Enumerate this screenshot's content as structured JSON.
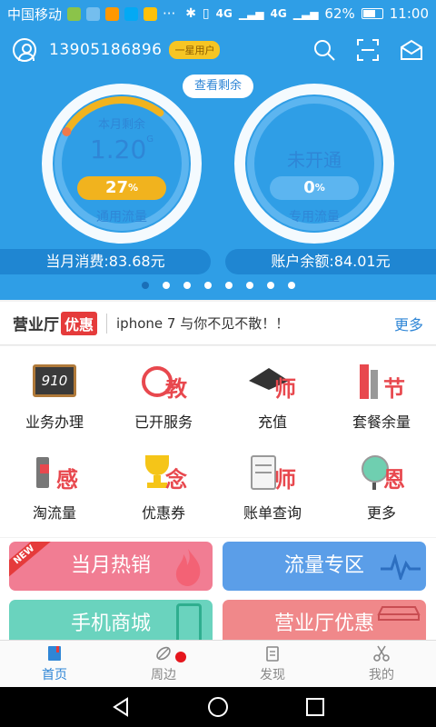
{
  "status_bar": {
    "carrier": "中国移动",
    "network": "4G",
    "network2": "4G",
    "battery": "62%",
    "time": "11:00",
    "more": "···"
  },
  "header": {
    "phone": "13905186896",
    "vip_badge": "一星用户",
    "query_button": "查看剩余",
    "gauge_general": {
      "caption": "本月剩余",
      "value": "1.20",
      "unit": "G",
      "percent": "27",
      "percent_sign": "%",
      "label": "通用流量",
      "fill_fraction": 0.27
    },
    "gauge_special": {
      "status": "未开通",
      "percent": "0",
      "percent_sign": "%",
      "label": "专用流量",
      "fill_fraction": 0
    },
    "spend": "当月消费:83.68元",
    "balance": "账户余额:84.01元",
    "dots_count": 8,
    "dots_active": 0
  },
  "news": {
    "brand": "营业厅",
    "brand_tag": "优惠",
    "headline": "iphone 7 与你不见不散！！",
    "more": "更多"
  },
  "grid": [
    {
      "label": "业务办理",
      "icon": "chalkboard-910-icon",
      "icon_text": "910"
    },
    {
      "label": "已开服务",
      "icon": "alarm-clock-icon",
      "icon_text": "教"
    },
    {
      "label": "充值",
      "icon": "graduation-cap-icon",
      "icon_text": "师"
    },
    {
      "label": "套餐余量",
      "icon": "books-icon",
      "icon_text": "节"
    },
    {
      "label": "淘流量",
      "icon": "bookmark-stand-icon",
      "icon_text": "感"
    },
    {
      "label": "优惠券",
      "icon": "trophy-icon",
      "icon_text": "念"
    },
    {
      "label": "账单查询",
      "icon": "scroll-icon",
      "icon_text": "师"
    },
    {
      "label": "更多",
      "icon": "globe-icon",
      "icon_text": "恩"
    }
  ],
  "banners": {
    "hot": "当月热销",
    "new_ribbon": "NEW",
    "data_zone": "流量专区",
    "mall": "手机商城",
    "offers": "营业厅优惠"
  },
  "tabs": [
    {
      "label": "首页",
      "icon": "book-icon"
    },
    {
      "label": "周边",
      "icon": "leaf-icon"
    },
    {
      "label": "发现",
      "icon": "clipboard-icon"
    },
    {
      "label": "我的",
      "icon": "scissors-icon"
    }
  ],
  "colors": {
    "primary": "#2f9ee6",
    "accent_yellow": "#f1b31e",
    "accent_red": "#e53b3b",
    "tab_active": "#2f86d6"
  }
}
